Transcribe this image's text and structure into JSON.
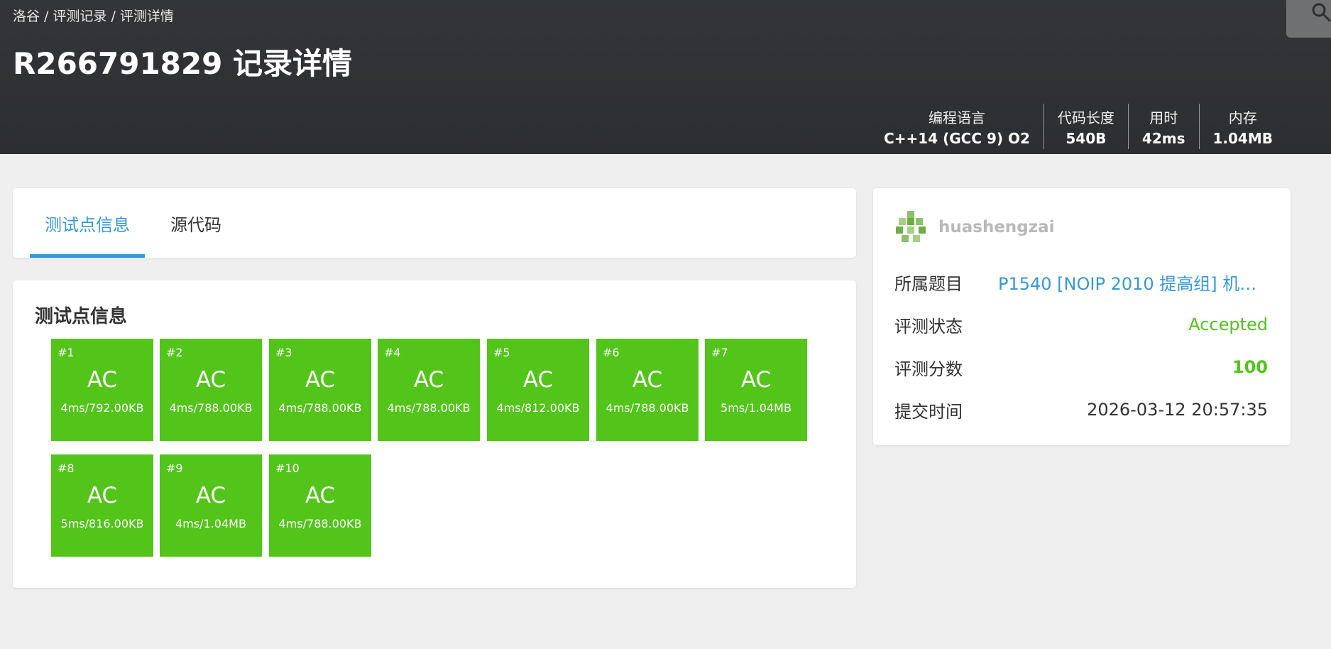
{
  "breadcrumb": [
    "洛谷",
    "/",
    "评测记录",
    "/",
    "评测详情"
  ],
  "title": "R266791829 记录详情",
  "stats": [
    {
      "label": "编程语言",
      "value": "C++14 (GCC 9) O2"
    },
    {
      "label": "代码长度",
      "value": "540B"
    },
    {
      "label": "用时",
      "value": "42ms"
    },
    {
      "label": "内存",
      "value": "1.04MB"
    }
  ],
  "tabs": [
    {
      "label": "测试点信息",
      "active": true
    },
    {
      "label": "源代码",
      "active": false
    }
  ],
  "cases_title": "测试点信息",
  "cases": [
    {
      "num": "#1",
      "status": "AC",
      "usage": "4ms/792.00KB"
    },
    {
      "num": "#2",
      "status": "AC",
      "usage": "4ms/788.00KB"
    },
    {
      "num": "#3",
      "status": "AC",
      "usage": "4ms/788.00KB"
    },
    {
      "num": "#4",
      "status": "AC",
      "usage": "4ms/788.00KB"
    },
    {
      "num": "#5",
      "status": "AC",
      "usage": "4ms/812.00KB"
    },
    {
      "num": "#6",
      "status": "AC",
      "usage": "4ms/788.00KB"
    },
    {
      "num": "#7",
      "status": "AC",
      "usage": "5ms/1.04MB"
    },
    {
      "num": "#8",
      "status": "AC",
      "usage": "5ms/816.00KB"
    },
    {
      "num": "#9",
      "status": "AC",
      "usage": "4ms/1.04MB"
    },
    {
      "num": "#10",
      "status": "AC",
      "usage": "4ms/788.00KB"
    }
  ],
  "user": {
    "name": "huashengzai"
  },
  "info": [
    {
      "label": "所属题目",
      "value": "P1540 [NOIP 2010 提高组] 机器..."
    },
    {
      "label": "评测状态",
      "value": "Accepted"
    },
    {
      "label": "评测分数",
      "value": "100"
    },
    {
      "label": "提交时间",
      "value": "2026-03-12 20:57:35"
    }
  ],
  "colors": {
    "accent": "#3498db",
    "ac_green": "#52c41a",
    "header_bg": "#2f3033",
    "page_bg": "#efefef"
  },
  "icons": {
    "search": "search-icon",
    "avatar": "avatar-icon"
  }
}
